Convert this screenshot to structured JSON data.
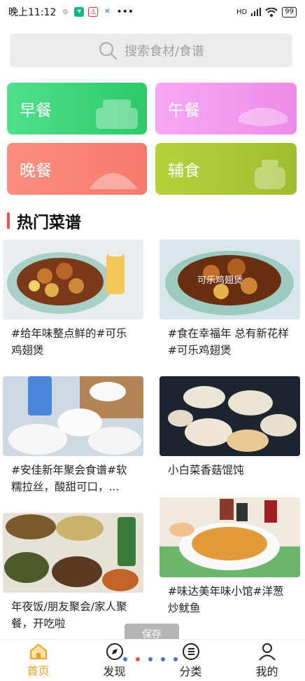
{
  "status": {
    "time": "晚上11:12",
    "battery": "99",
    "network": "HD"
  },
  "search": {
    "placeholder": "搜索食材/食谱"
  },
  "categories": [
    {
      "label": "早餐",
      "color": "#3fd67a"
    },
    {
      "label": "午餐",
      "color": "#f39cf0"
    },
    {
      "label": "晚餐",
      "color": "#f9857a"
    },
    {
      "label": "辅食",
      "color": "#a9c836"
    }
  ],
  "section": {
    "title": "热门菜谱"
  },
  "recipes": [
    {
      "title": "#给年味整点鲜的#可乐鸡翅煲"
    },
    {
      "title": "#食在幸福年 总有新花样#可乐鸡翅煲",
      "overlay": "可乐鸡翅煲"
    },
    {
      "title": "#安佳新年聚会食谱#软糯拉丝，酸甜可口，..."
    },
    {
      "title": "小白菜香菇馄饨"
    },
    {
      "title": "年夜饭/朋友聚会/家人聚餐，开吃啦"
    },
    {
      "title": "#味达美年味小馆#洋葱炒鱿鱼"
    }
  ],
  "toast": {
    "text": "保存"
  },
  "tabs": [
    {
      "label": "首页",
      "icon": "home-icon"
    },
    {
      "label": "发现",
      "icon": "compass-icon"
    },
    {
      "label": "分类",
      "icon": "list-icon"
    },
    {
      "label": "我的",
      "icon": "user-icon"
    }
  ],
  "colors": {
    "accent": "#f0a020",
    "section_bar": "#e8534a"
  }
}
